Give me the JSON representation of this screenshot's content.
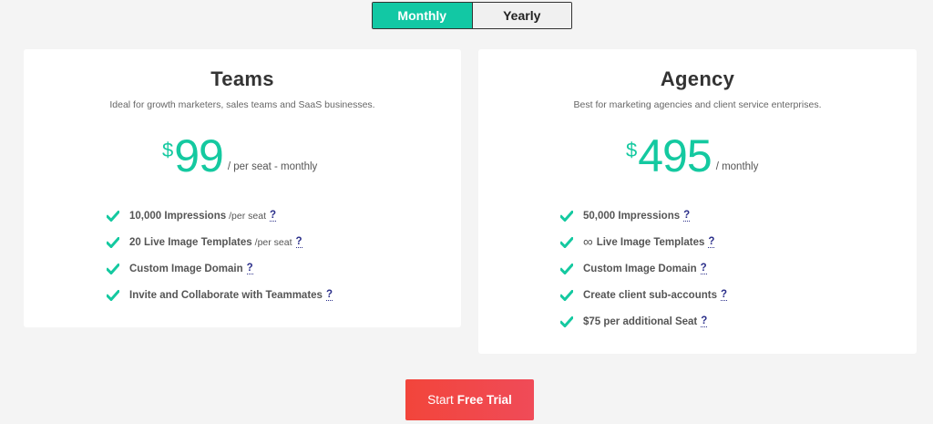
{
  "toggle": {
    "monthly": "Monthly",
    "yearly": "Yearly"
  },
  "colors": {
    "accent": "#12c8a4",
    "cta": "#f2453b",
    "tooltip": "#2b2f8a"
  },
  "plans": [
    {
      "name": "Teams",
      "description": "Ideal for growth marketers, sales teams and SaaS businesses.",
      "currency": "$",
      "price": "99",
      "period": "/ per seat - monthly",
      "features": [
        {
          "text": "10,000 Impressions",
          "sub": "/per seat",
          "help": "?"
        },
        {
          "text": "20 Live Image Templates",
          "sub": "/per seat",
          "help": "?"
        },
        {
          "text": "Custom Image Domain",
          "help": "?"
        },
        {
          "text": "Invite and Collaborate with Teammates",
          "help": "?"
        }
      ]
    },
    {
      "name": "Agency",
      "description": "Best for marketing agencies and client service enterprises.",
      "currency": "$",
      "price": "495",
      "period": "/ monthly",
      "features": [
        {
          "text": "50,000 Impressions",
          "help": "?"
        },
        {
          "prefix": "∞",
          "text": "Live Image Templates",
          "help": "?"
        },
        {
          "text": "Custom Image Domain",
          "help": "?"
        },
        {
          "text": "Create client sub-accounts",
          "help": "?"
        },
        {
          "text": "$75 per additional Seat",
          "help": "?"
        }
      ]
    }
  ],
  "cta": {
    "prefix": "Start",
    "bold": "Free Trial"
  }
}
